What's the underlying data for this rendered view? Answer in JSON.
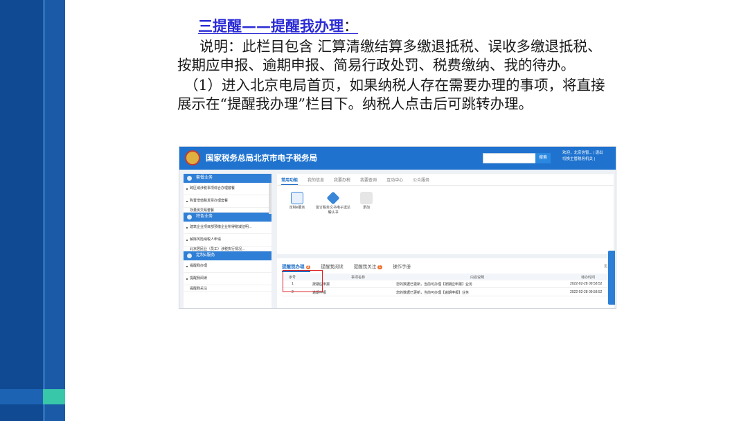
{
  "slide": {
    "heading": "三提醒——提醒我办理",
    "heading_colon": "：",
    "paragraph1": "说明：此栏目包含 汇算清缴结算多缴退抵税、误收多缴退抵税、按期应申报、逾期申报、简易行政处罚、税费缴纳、我的待办。",
    "paragraph2": "（1）进入北京电局首页，如果纳税人存在需要办理的事项，将直接展示在“提醒我办理”栏目下。纳税人点击后可跳转办理。"
  },
  "screenshot": {
    "site_title": "国家税务总局北京市电子税务局",
    "search_button": "搜索",
    "user_info_line1": "欢迎，北京信智...  |  退出",
    "user_info_line2": "切换主管税务机关  |",
    "sidebar": {
      "sections": [
        {
          "title": "套餐业务",
          "items": [
            "跨区域涉税事项综合办理套餐",
            "购置增值税发票办理套餐",
            "存量房交易套餐"
          ]
        },
        {
          "title": "特色业务",
          "items": [
            "建筑企业项目部预缴企业所得税减征明...",
            "解除风险纳税人申请",
            "北京居民业（员工）涉税执行情况..."
          ]
        },
        {
          "title": "定制e服务",
          "items": [
            "提醒我办理",
            "提醒我阅读",
            "提醒我关注"
          ]
        }
      ]
    },
    "top_tabs": [
      "常用功能",
      "我的信息",
      "我要办税",
      "我要查询",
      "互动中心",
      "公众服务"
    ],
    "functions": [
      {
        "label": "定制e服务"
      },
      {
        "label": "签订税务文书电子送达确认书"
      },
      {
        "label": "添加"
      }
    ],
    "bottom_tabs": [
      {
        "label": "提醒我办理",
        "badge": "2"
      },
      {
        "label": "提醒我阅读",
        "badge": ""
      },
      {
        "label": "提醒我关注",
        "badge": "1"
      },
      {
        "label": "操作手册",
        "badge": ""
      }
    ],
    "more_label": "更多",
    "table": {
      "headers": [
        "序号",
        "事项名称",
        "内容说明",
        "待办时间"
      ],
      "rows": [
        [
          "1",
          "按期应申报",
          "您的数据已更新，当前可办理【按期应申报】业务",
          "2022-02-28 09:58:52"
        ],
        [
          "2",
          "逾期申报",
          "您的数据已更新，当前可办理【逾期申报】业务",
          "2022-02-28 09:58:52"
        ]
      ]
    }
  }
}
